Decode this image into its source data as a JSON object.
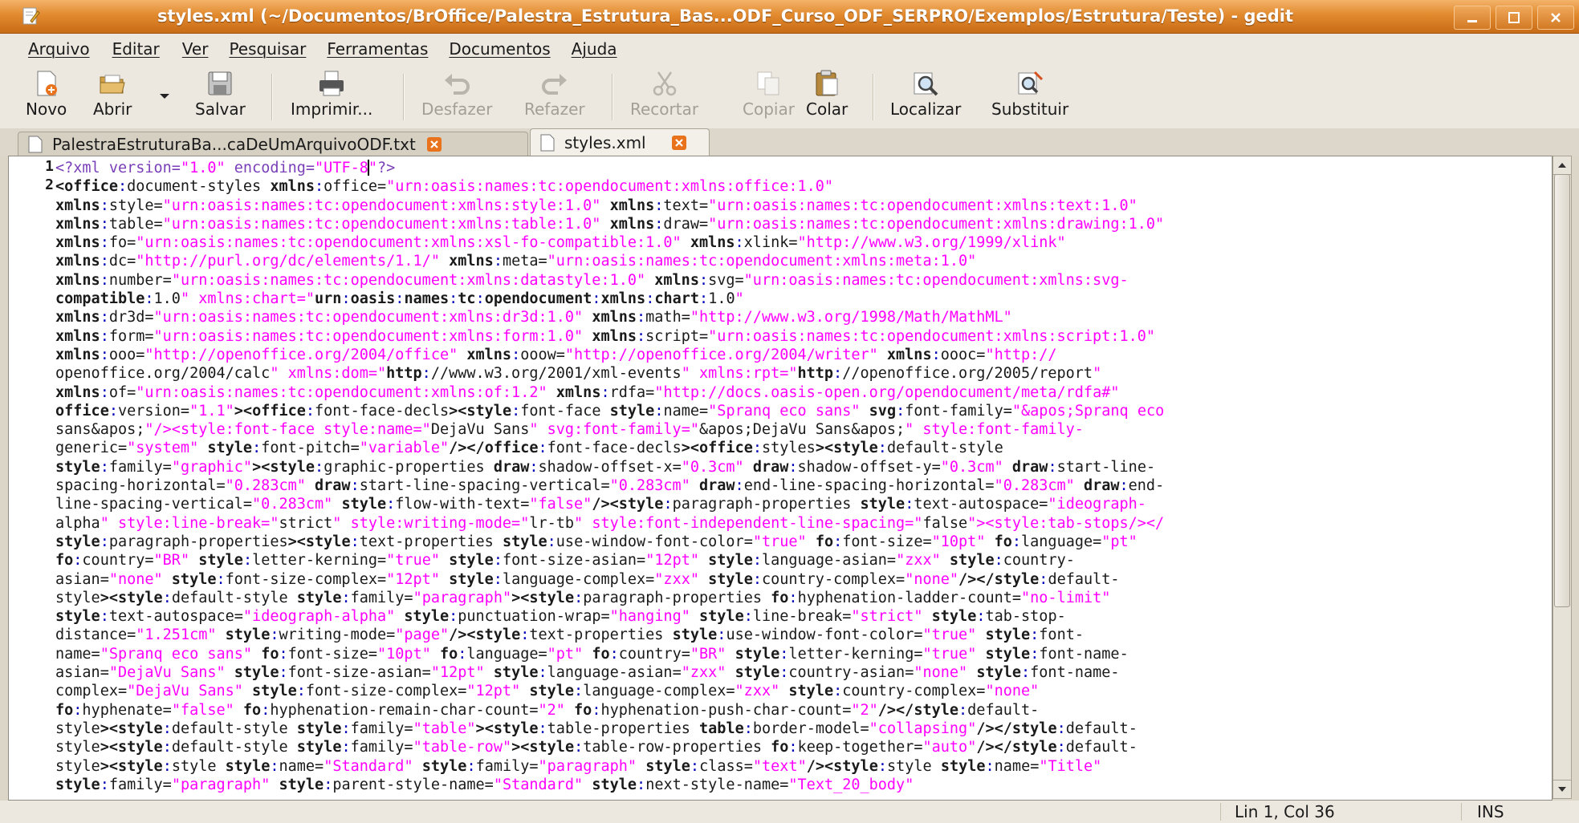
{
  "window": {
    "title": "styles.xml (~/Documentos/BrOffice/Palestra_Estrutura_Bas...ODF_Curso_ODF_SERPRO/Exemplos/Estrutura/Teste) - gedit",
    "accent": "#e28a2e"
  },
  "menu": [
    "Arquivo",
    "Editar",
    "Ver",
    "Pesquisar",
    "Ferramentas",
    "Documentos",
    "Ajuda"
  ],
  "toolbar": {
    "new": "Novo",
    "open": "Abrir",
    "save": "Salvar",
    "print": "Imprimir...",
    "undo": "Desfazer",
    "redo": "Refazer",
    "cut": "Recortar",
    "copy": "Copiar",
    "paste": "Colar",
    "find": "Localizar",
    "replace": "Substituir"
  },
  "tabs": [
    {
      "label": "PalestraEstruturaBa...caDeUmArquivoODF.txt",
      "active": false
    },
    {
      "label": "styles.xml",
      "active": true
    }
  ],
  "editor": {
    "line_numbers": [
      "1",
      "2"
    ],
    "lines": [
      "<?xml version=\"1.0\" encoding=\"UTF-8\"?>",
      "<office:document-styles xmlns:office=\"urn:oasis:names:tc:opendocument:xmlns:office:1.0\"",
      "xmlns:style=\"urn:oasis:names:tc:opendocument:xmlns:style:1.0\" xmlns:text=\"urn:oasis:names:tc:opendocument:xmlns:text:1.0\"",
      "xmlns:table=\"urn:oasis:names:tc:opendocument:xmlns:table:1.0\" xmlns:draw=\"urn:oasis:names:tc:opendocument:xmlns:drawing:1.0\"",
      "xmlns:fo=\"urn:oasis:names:tc:opendocument:xmlns:xsl-fo-compatible:1.0\" xmlns:xlink=\"http://www.w3.org/1999/xlink\"",
      "xmlns:dc=\"http://purl.org/dc/elements/1.1/\" xmlns:meta=\"urn:oasis:names:tc:opendocument:xmlns:meta:1.0\"",
      "xmlns:number=\"urn:oasis:names:tc:opendocument:xmlns:datastyle:1.0\" xmlns:svg=\"urn:oasis:names:tc:opendocument:xmlns:svg-",
      "compatible:1.0\" xmlns:chart=\"urn:oasis:names:tc:opendocument:xmlns:chart:1.0\"",
      "xmlns:dr3d=\"urn:oasis:names:tc:opendocument:xmlns:dr3d:1.0\" xmlns:math=\"http://www.w3.org/1998/Math/MathML\"",
      "xmlns:form=\"urn:oasis:names:tc:opendocument:xmlns:form:1.0\" xmlns:script=\"urn:oasis:names:tc:opendocument:xmlns:script:1.0\"",
      "xmlns:ooo=\"http://openoffice.org/2004/office\" xmlns:ooow=\"http://openoffice.org/2004/writer\" xmlns:oooc=\"http://",
      "openoffice.org/2004/calc\" xmlns:dom=\"http://www.w3.org/2001/xml-events\" xmlns:rpt=\"http://openoffice.org/2005/report\"",
      "xmlns:of=\"urn:oasis:names:tc:opendocument:xmlns:of:1.2\" xmlns:rdfa=\"http://docs.oasis-open.org/opendocument/meta/rdfa#\"",
      "office:version=\"1.1\"><office:font-face-decls><style:font-face style:name=\"Spranq eco sans\" svg:font-family=\"&apos;Spranq eco",
      "sans&apos;\"/><style:font-face style:name=\"DejaVu Sans\" svg:font-family=\"&apos;DejaVu Sans&apos;\" style:font-family-",
      "generic=\"system\" style:font-pitch=\"variable\"/></office:font-face-decls><office:styles><style:default-style",
      "style:family=\"graphic\"><style:graphic-properties draw:shadow-offset-x=\"0.3cm\" draw:shadow-offset-y=\"0.3cm\" draw:start-line-",
      "spacing-horizontal=\"0.283cm\" draw:start-line-spacing-vertical=\"0.283cm\" draw:end-line-spacing-horizontal=\"0.283cm\" draw:end-",
      "line-spacing-vertical=\"0.283cm\" style:flow-with-text=\"false\"/><style:paragraph-properties style:text-autospace=\"ideograph-",
      "alpha\" style:line-break=\"strict\" style:writing-mode=\"lr-tb\" style:font-independent-line-spacing=\"false\"><style:tab-stops/></",
      "style:paragraph-properties><style:text-properties style:use-window-font-color=\"true\" fo:font-size=\"10pt\" fo:language=\"pt\"",
      "fo:country=\"BR\" style:letter-kerning=\"true\" style:font-size-asian=\"12pt\" style:language-asian=\"zxx\" style:country-",
      "asian=\"none\" style:font-size-complex=\"12pt\" style:language-complex=\"zxx\" style:country-complex=\"none\"/></style:default-",
      "style><style:default-style style:family=\"paragraph\"><style:paragraph-properties fo:hyphenation-ladder-count=\"no-limit\"",
      "style:text-autospace=\"ideograph-alpha\" style:punctuation-wrap=\"hanging\" style:line-break=\"strict\" style:tab-stop-",
      "distance=\"1.251cm\" style:writing-mode=\"page\"/><style:text-properties style:use-window-font-color=\"true\" style:font-",
      "name=\"Spranq eco sans\" fo:font-size=\"10pt\" fo:language=\"pt\" fo:country=\"BR\" style:letter-kerning=\"true\" style:font-name-",
      "asian=\"DejaVu Sans\" style:font-size-asian=\"12pt\" style:language-asian=\"zxx\" style:country-asian=\"none\" style:font-name-",
      "complex=\"DejaVu Sans\" style:font-size-complex=\"12pt\" style:language-complex=\"zxx\" style:country-complex=\"none\"",
      "fo:hyphenate=\"false\" fo:hyphenation-remain-char-count=\"2\" fo:hyphenation-push-char-count=\"2\"/></style:default-",
      "style><style:default-style style:family=\"table\"><style:table-properties table:border-model=\"collapsing\"/></style:default-",
      "style><style:default-style style:family=\"table-row\"><style:table-row-properties fo:keep-together=\"auto\"/></style:default-",
      "style><style:style style:name=\"Standard\" style:family=\"paragraph\" style:class=\"text\"/><style:style style:name=\"Title\"",
      "style:family=\"paragraph\" style:parent-style-name=\"Standard\" style:next-style-name=\"Text_20_body\""
    ]
  },
  "status": {
    "position": "Lin 1, Col 36",
    "mode": "INS"
  }
}
